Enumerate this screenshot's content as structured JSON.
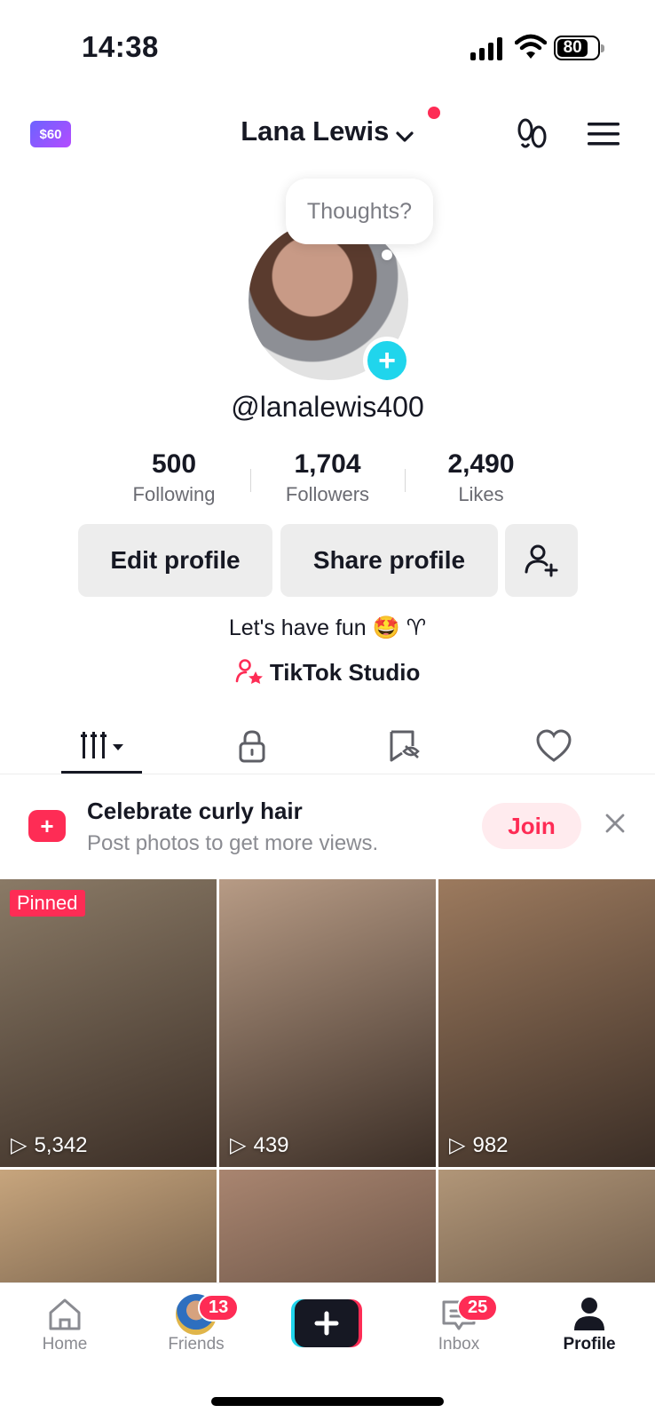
{
  "status_bar": {
    "time": "14:38",
    "battery": "80"
  },
  "header": {
    "coins": "$60",
    "title": "Lana Lewis"
  },
  "profile": {
    "bubble": "Thoughts?",
    "username": "@lanalewis400",
    "stats": [
      {
        "value": "500",
        "label": "Following"
      },
      {
        "value": "1,704",
        "label": "Followers"
      },
      {
        "value": "2,490",
        "label": "Likes"
      }
    ],
    "buttons": {
      "edit": "Edit profile",
      "share": "Share profile"
    },
    "bio": "Let's have fun 🤩 ♈",
    "studio": "TikTok Studio"
  },
  "promo": {
    "title": "Celebrate curly hair",
    "subtitle": "Post photos to get more views.",
    "join": "Join"
  },
  "videos": [
    {
      "pinned": "Pinned",
      "views": "5,342",
      "bg": "#8a7a66"
    },
    {
      "pinned": "",
      "views": "439",
      "bg": "#b79b85"
    },
    {
      "pinned": "",
      "views": "982",
      "bg": "#9c7a5e"
    },
    {
      "pinned": "",
      "views": "",
      "bg": "#c7a57d"
    },
    {
      "pinned": "",
      "views": "",
      "bg": "#a98570"
    },
    {
      "pinned": "",
      "views": "",
      "bg": "#b19678"
    }
  ],
  "nav": {
    "home": "Home",
    "friends": "Friends",
    "friends_badge": "13",
    "inbox": "Inbox",
    "inbox_badge": "25",
    "profile": "Profile"
  },
  "colors": {
    "accent": "#fe2c55",
    "cyan": "#20d5ec"
  }
}
